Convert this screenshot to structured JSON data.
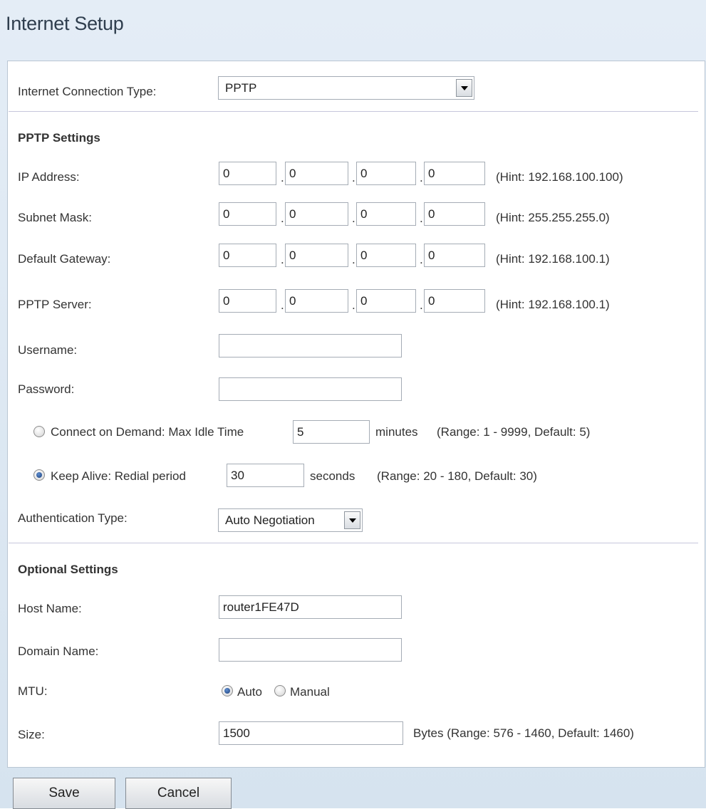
{
  "title": "Internet Setup",
  "connection_type": {
    "label": "Internet Connection Type:",
    "value": "PPTP"
  },
  "pptp": {
    "heading": "PPTP Settings",
    "ip_address": {
      "label": "IP Address:",
      "octets": [
        "0",
        "0",
        "0",
        "0"
      ],
      "hint": "(Hint: 192.168.100.100)"
    },
    "subnet_mask": {
      "label": "Subnet Mask:",
      "octets": [
        "0",
        "0",
        "0",
        "0"
      ],
      "hint": "(Hint: 255.255.255.0)"
    },
    "default_gateway": {
      "label": "Default Gateway:",
      "octets": [
        "0",
        "0",
        "0",
        "0"
      ],
      "hint": "(Hint: 192.168.100.1)"
    },
    "pptp_server": {
      "label": "PPTP Server:",
      "octets": [
        "0",
        "0",
        "0",
        "0"
      ],
      "hint": "(Hint: 192.168.100.1)"
    },
    "username": {
      "label": "Username:",
      "value": ""
    },
    "password": {
      "label": "Password:",
      "value": ""
    },
    "connect_on_demand": {
      "label": "Connect on Demand: Max Idle Time",
      "value": "5",
      "unit": "minutes",
      "hint": "(Range: 1 - 9999, Default: 5)",
      "selected": false
    },
    "keep_alive": {
      "label": "Keep Alive: Redial period",
      "value": "30",
      "unit": "seconds",
      "hint": "(Range: 20 - 180, Default: 30)",
      "selected": true
    },
    "auth_type": {
      "label": "Authentication Type:",
      "value": "Auto Negotiation"
    }
  },
  "optional": {
    "heading": "Optional Settings",
    "host_name": {
      "label": "Host Name:",
      "value": "router1FE47D"
    },
    "domain_name": {
      "label": "Domain Name:",
      "value": ""
    },
    "mtu": {
      "label": "MTU:",
      "auto_label": "Auto",
      "manual_label": "Manual",
      "selected": "Auto"
    },
    "size": {
      "label": "Size:",
      "value": "1500",
      "hint": "Bytes (Range: 576 - 1460, Default: 1460)"
    }
  },
  "buttons": {
    "save": "Save",
    "cancel": "Cancel"
  }
}
